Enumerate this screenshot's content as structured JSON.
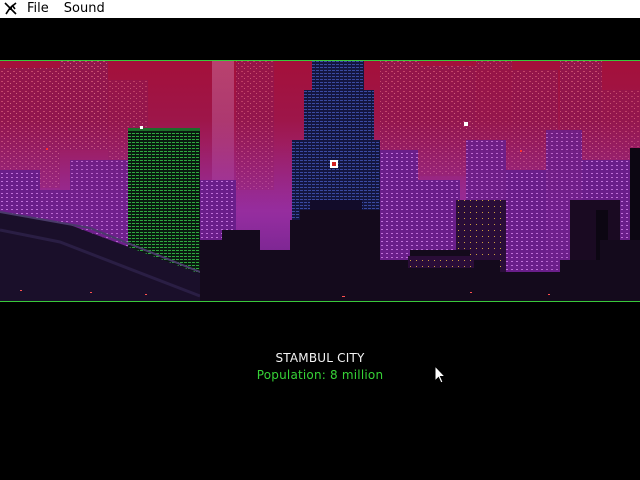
{
  "menu": {
    "items": [
      "File",
      "Sound"
    ]
  },
  "icons": {
    "app": "app-icon",
    "cursor": "arrow-cursor-icon"
  },
  "city": {
    "name": "STAMBUL CITY",
    "population": "Population: 8 million"
  },
  "colors": {
    "menubar_bg": "#ffffff",
    "background": "#000000",
    "scene_border": "#39c83a",
    "sky_top": "#a8123e",
    "sky_mid": "#8c1a6a",
    "haze": "#8f2ba8",
    "city_name": "#f4f4f4",
    "population": "#37d237"
  }
}
